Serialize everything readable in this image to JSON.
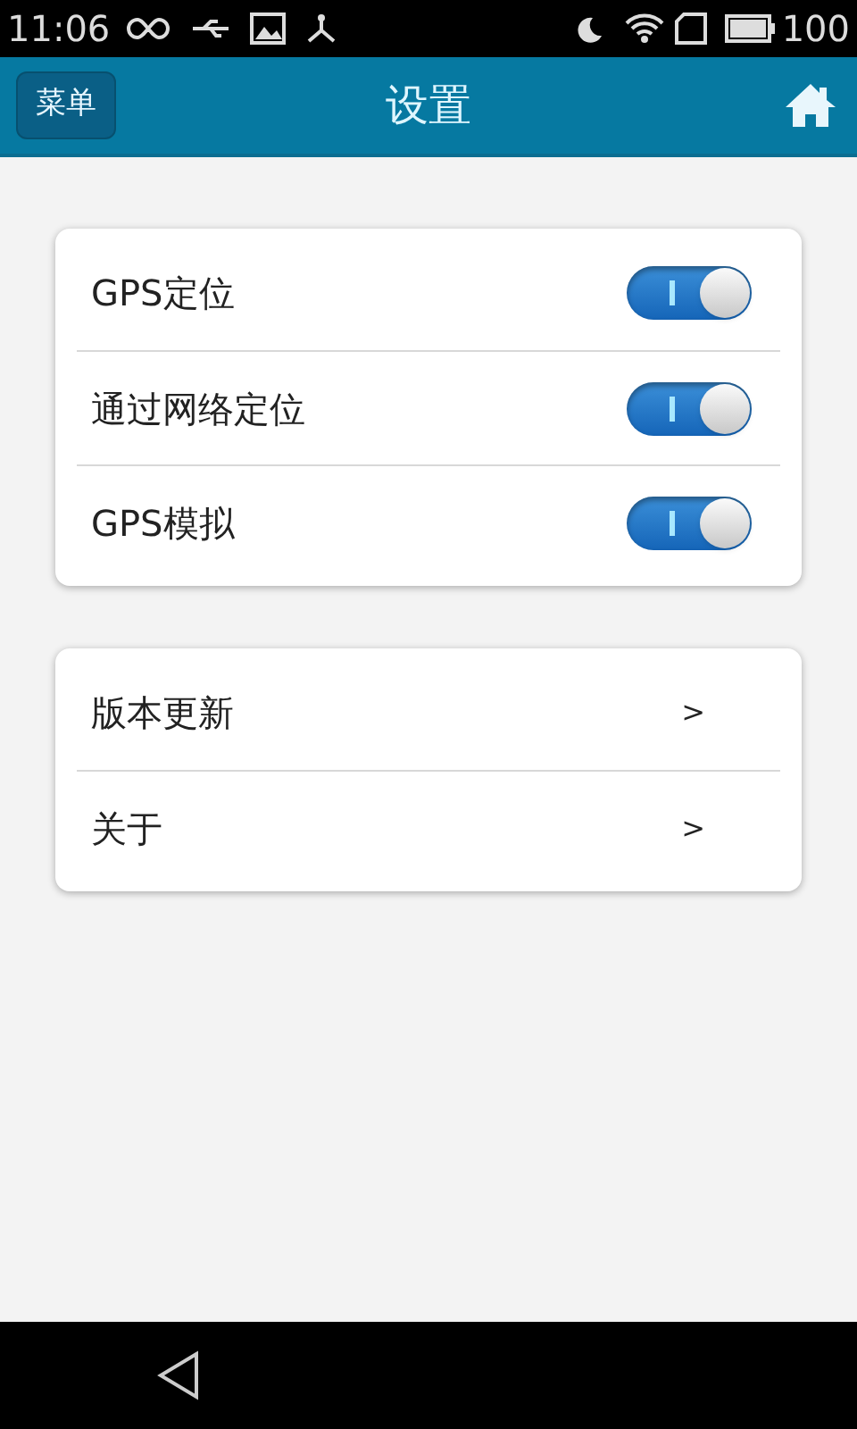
{
  "status_bar": {
    "time": "11:06",
    "battery": "100"
  },
  "header": {
    "menu_button": "菜单",
    "title": "设置"
  },
  "toggles": [
    {
      "label": "GPS定位",
      "on": true
    },
    {
      "label": "通过网络定位",
      "on": true
    },
    {
      "label": "GPS模拟",
      "on": true
    }
  ],
  "links": [
    {
      "label": "版本更新",
      "chevron": ">"
    },
    {
      "label": "关于",
      "chevron": ">"
    }
  ]
}
